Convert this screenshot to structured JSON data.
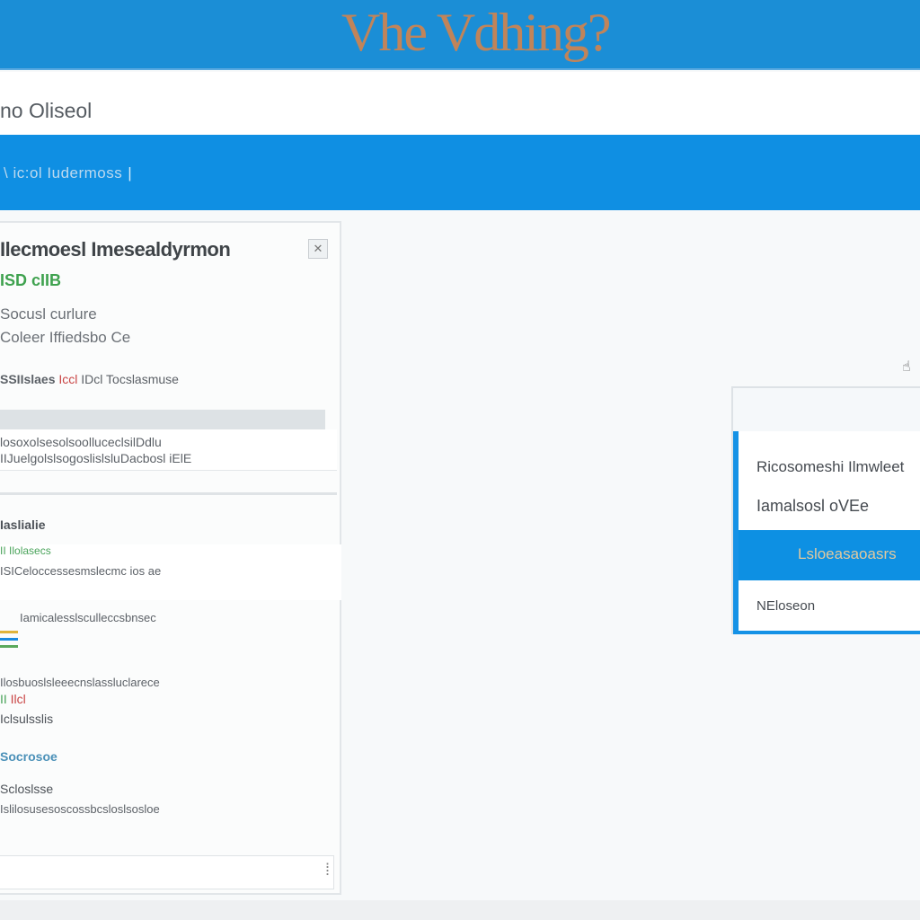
{
  "header": {
    "logo_text": "Vhe Vdhing?",
    "brand_color": "#1b8ed6",
    "logo_color": "#c0845a"
  },
  "subheader": {
    "title": "no Oliseol"
  },
  "search": {
    "value": "\\ ic:ol Iudermoss",
    "caret": "|"
  },
  "detail_panel": {
    "title": "Ilecmoesl Imesealdyrmon",
    "close_icon": "close-icon",
    "code": "ISD cIIB",
    "info_lines": [
      "Socusl curlure",
      "Coleer Iffiedsbo Ce"
    ],
    "status_row": {
      "label": "SSIIslaes",
      "mark": "Iccl",
      "text": "IDcl Tocslasmuse"
    },
    "address_lines": [
      "losoxolsesolsoolluceclsilDdlu",
      "IIJuelgolslsogoslislsluDacbosl iElE"
    ],
    "section_label": "Iaslialie",
    "list_header_prefix": "II",
    "list_header": "Ilolasecs",
    "list_rows": [
      "ISICeloccessesmslecmc ios ae",
      "Iamicalesslsculleccsbnsec",
      "Ilosbuoslsleeecnslassluclarece"
    ],
    "mark_row": {
      "mark": "Ilcl",
      "prefix": "II"
    },
    "labels": [
      "Iclsulsslis",
      "Socrosoe",
      "Scloslsse"
    ],
    "footer_line": "Islilosusesoscossbcsloslsosloe",
    "stripe_colors": [
      "#e0b43b",
      "#1a8be0",
      "#5aa95c"
    ]
  },
  "dropdown": {
    "items": [
      {
        "label": "Ricosomeshi Ilmwleet"
      },
      {
        "label": "Iamalsosl oVEe"
      },
      {
        "label": "Lsloeasaoasrs",
        "selected": true
      },
      {
        "label": "NEloseon"
      }
    ],
    "accent": "#1592e6"
  }
}
